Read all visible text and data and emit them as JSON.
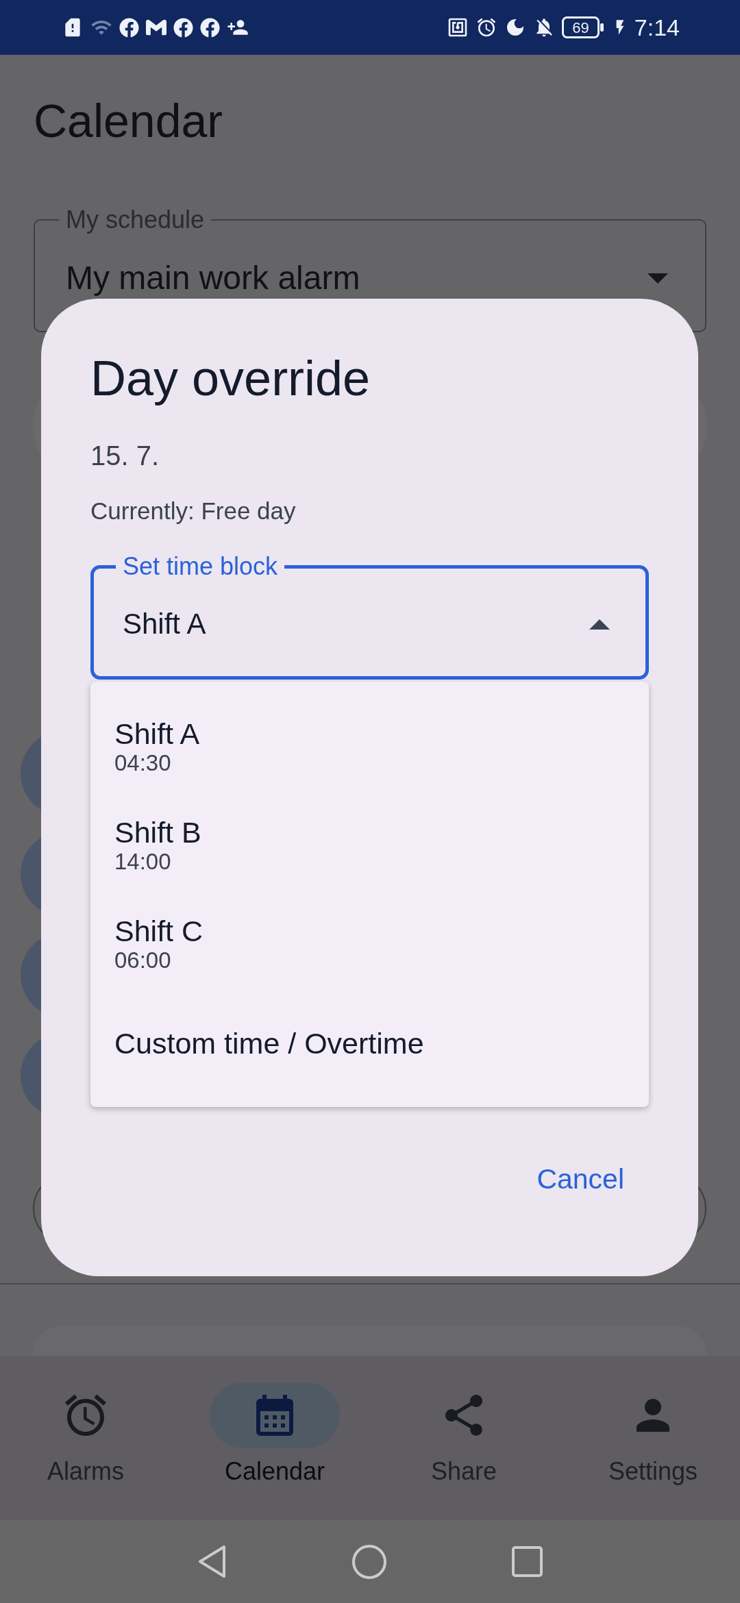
{
  "status_bar": {
    "battery": "69",
    "time": "7:14"
  },
  "page": {
    "title": "Calendar",
    "schedule_field": {
      "label": "My schedule",
      "value": "My main work alarm",
      "expanded": false
    }
  },
  "dialog": {
    "title": "Day override",
    "date": "15. 7.",
    "current_status": "Currently: Free day",
    "time_block_field": {
      "label": "Set time block",
      "value": "Shift A",
      "expanded": true
    },
    "options": [
      {
        "label": "Shift A",
        "time": "04:30"
      },
      {
        "label": "Shift B",
        "time": "14:00"
      },
      {
        "label": "Shift C",
        "time": "06:00"
      },
      {
        "label": "Custom time / Overtime"
      }
    ],
    "buttons": [
      "Cancel"
    ]
  },
  "bottom_nav": [
    {
      "label": "Alarms",
      "selected": false
    },
    {
      "label": "Calendar",
      "selected": true
    },
    {
      "label": "Share",
      "selected": false
    },
    {
      "label": "Settings",
      "selected": false
    }
  ]
}
